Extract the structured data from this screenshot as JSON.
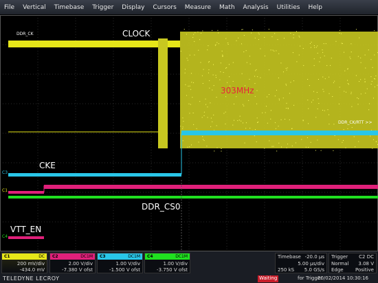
{
  "menu": [
    "File",
    "Vertical",
    "Timebase",
    "Trigger",
    "Display",
    "Cursors",
    "Measure",
    "Math",
    "Analysis",
    "Utilities",
    "Help"
  ],
  "traces": {
    "clock_label": "CLOCK",
    "clock_small_label": "DDR_CK",
    "freq_label": "303MHz",
    "cke_label": "CKE",
    "cs_label": "DDR_CS0",
    "vtt_label": "VTT_EN",
    "right_marker": "DDR_CK/RTT >>",
    "markers": {
      "c3": "C3",
      "c1": "C1",
      "c4": "C4"
    }
  },
  "colors": {
    "c1": "#e6e619",
    "c2": "#e0207a",
    "c3": "#29c6e8",
    "c4": "#20e020",
    "c1_alt": "#c8c820"
  },
  "channels": [
    {
      "tag": "C1",
      "coupling": "DC",
      "line1": "200 mV/div",
      "line2": "-434.0 mV",
      "color": "#e6e619"
    },
    {
      "tag": "C2",
      "coupling": "DC1M",
      "line1": "2.00 V/div",
      "line2": "-7.380 V ofst",
      "color": "#e0207a"
    },
    {
      "tag": "C3",
      "coupling": "DC1M",
      "line1": "1.00 V/div",
      "line2": "-1.500 V ofst",
      "color": "#29c6e8"
    },
    {
      "tag": "C4",
      "coupling": "DC1M",
      "line1": "1.00 V/div",
      "line2": "-3.750 V ofst",
      "color": "#20e020"
    }
  ],
  "timebase": {
    "title": "Timebase",
    "delay": "-20.0 µs",
    "scale": "5.00 µs/div",
    "samples": "250 kS",
    "rate": "5.0 GS/s"
  },
  "trigger": {
    "title": "Trigger",
    "source": "C2 DC",
    "mode": "Normal",
    "level": "3.08 V",
    "type": "Edge",
    "slope": "Positive"
  },
  "footer": {
    "brand": "TELEDYNE LECROY",
    "status": "Waiting",
    "status_rest": "for Trigger",
    "datetime": "20/02/2014 10:30:16"
  }
}
